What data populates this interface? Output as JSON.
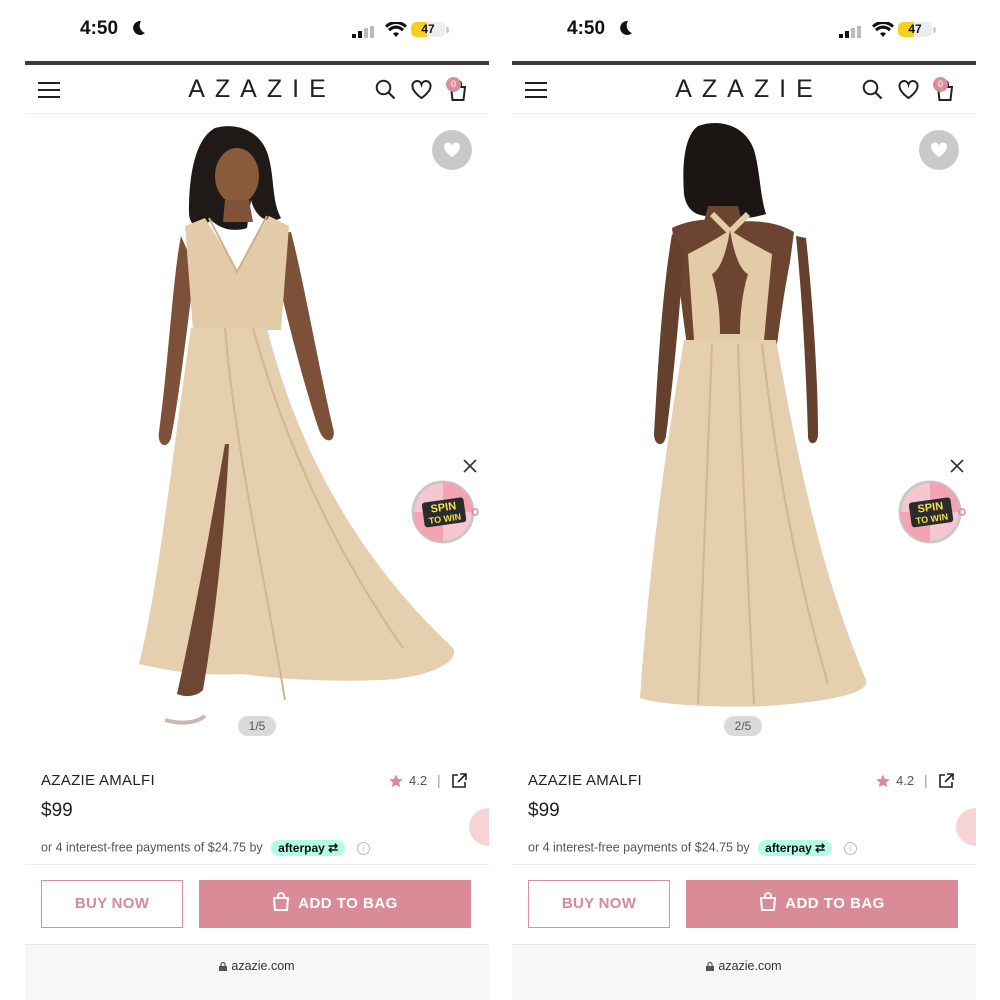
{
  "status": {
    "time": "4:50",
    "battery": "47",
    "battery_fill": 0.47
  },
  "header": {
    "brand": "AZAZIE"
  },
  "colors": {
    "accent": "#d98c98",
    "afterpay": "#b2fce4",
    "dress": "#e6cfae"
  },
  "screens": [
    {
      "image_counter": "1/5",
      "product": {
        "name": "AZAZIE AMALFI",
        "rating": "4.2",
        "price": "$99",
        "installments_text": "or 4 interest-free payments of $24.75 by",
        "afterpay_label": "afterpay"
      },
      "buttons": {
        "buy_now": "BUY NOW",
        "add_to_bag": "ADD TO BAG"
      },
      "url": "azazie.com",
      "promo": {
        "line1": "SPIN",
        "line2": "TO WIN"
      },
      "bag_count": "0"
    },
    {
      "image_counter": "2/5",
      "product": {
        "name": "AZAZIE AMALFI",
        "rating": "4.2",
        "price": "$99",
        "installments_text": "or 4 interest-free payments of $24.75 by",
        "afterpay_label": "afterpay"
      },
      "buttons": {
        "buy_now": "BUY NOW",
        "add_to_bag": "ADD TO BAG"
      },
      "url": "azazie.com",
      "promo": {
        "line1": "SPIN",
        "line2": "TO WIN"
      },
      "bag_count": "0"
    }
  ]
}
